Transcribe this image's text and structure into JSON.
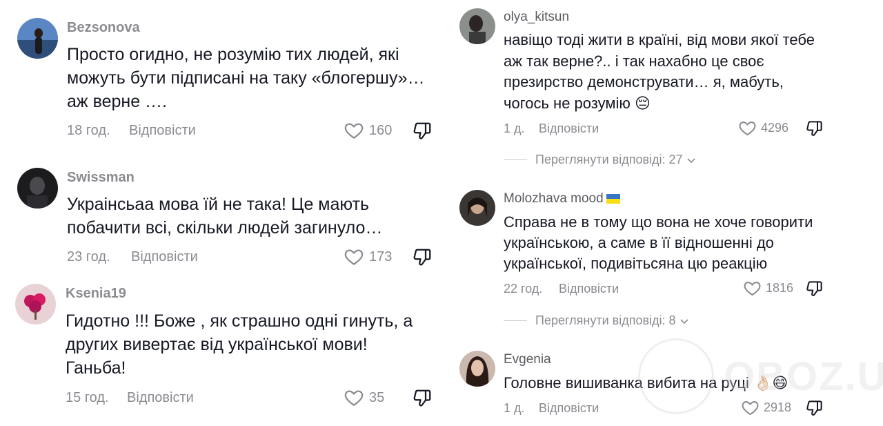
{
  "watermark": "OBOZ.UA",
  "left_comments": [
    {
      "username": "Bezsonova",
      "lines": [
        "Просто огидно, не розумію тих людей, які",
        "можуть бути підписані на таку «блогершу»…",
        "аж верне …."
      ],
      "time": "18 год.",
      "reply_label": "Відповісти",
      "likes": "160"
    },
    {
      "username": "Swissman",
      "lines": [
        "Украінсьаа мова їй не така! Це мають",
        "побачити всі, скільки людей загинуло…"
      ],
      "time": "23 год.",
      "reply_label": "Відповісти",
      "likes": "173"
    },
    {
      "username": "Ksenia19",
      "lines": [
        "Гидотно !!! Боже , як страшно одні гинуть, а",
        "других вивертає від української мови!",
        "Ганьба!"
      ],
      "time": "15 год.",
      "reply_label": "Відповісти",
      "likes": "35"
    }
  ],
  "right_comments": [
    {
      "username": "olya_kitsun",
      "lines": [
        "навіщо тоді жити в країні, від мови якої тебе",
        "аж так верне?.. і так нахабно це своє",
        "презирство демонструвати… я, мабуть,",
        "чогось не розумію 😔"
      ],
      "time": "1 д.",
      "reply_label": "Відповісти",
      "likes": "4296",
      "view_replies": "Переглянути відповіді: 27"
    },
    {
      "username": "Molozhava mood",
      "lines": [
        "Справа не в тому що вона не хоче говорити",
        "українською, а саме в її відношенні до",
        "української, подивітьсяна цю реакцію"
      ],
      "time": "22 год.",
      "reply_label": "Відповісти",
      "likes": "1816",
      "view_replies": "Переглянути відповіді: 8"
    },
    {
      "username": "Evgenia",
      "lines": [
        "Головне вишиванка вибита на руці 👌🏻😄"
      ],
      "time": "1 д.",
      "reply_label": "Відповісти",
      "likes": "2918"
    }
  ],
  "colors": {
    "text": "#161823",
    "muted": "#8a8b91",
    "flag_blue": "#3a75c4",
    "flag_yellow": "#f9dd16"
  }
}
